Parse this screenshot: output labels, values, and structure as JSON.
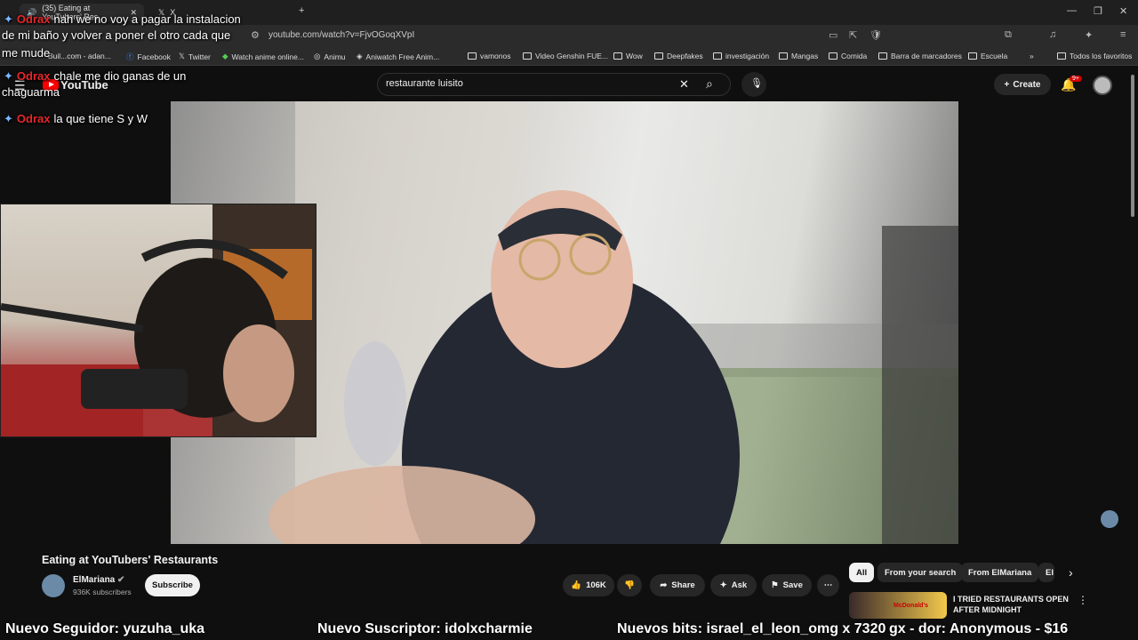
{
  "browser": {
    "tabs": [
      {
        "label": "(35) Eating at YouTubers' Res"
      },
      {
        "label": "X"
      }
    ],
    "url": "youtube.com/watch?v=FjvOGoqXVpI",
    "bookmarks": [
      {
        "label": "Buil...com - adan...",
        "icon": "site-icon"
      },
      {
        "label": "Facebook",
        "icon": "facebook-icon"
      },
      {
        "label": "Twitter",
        "icon": "x-icon"
      },
      {
        "label": "Watch anime online...",
        "icon": "site-icon"
      },
      {
        "label": "Animu",
        "icon": "globe-icon"
      },
      {
        "label": "Aniwatch Free Anim...",
        "icon": "site-icon"
      },
      {
        "label": "vamonos",
        "icon": "folder-icon"
      },
      {
        "label": "Video Genshin FUE...",
        "icon": "folder-icon"
      },
      {
        "label": "Wow",
        "icon": "folder-icon"
      },
      {
        "label": "Deepfakes",
        "icon": "folder-icon"
      },
      {
        "label": "investigación",
        "icon": "folder-icon"
      },
      {
        "label": "Mangas",
        "icon": "folder-icon"
      },
      {
        "label": "Comida",
        "icon": "folder-icon"
      },
      {
        "label": "Barra de marcadores",
        "icon": "folder-icon"
      },
      {
        "label": "Escuela",
        "icon": "folder-icon"
      },
      {
        "label": "Todos los favoritos",
        "icon": "folder-icon"
      }
    ]
  },
  "youtube": {
    "logo": "YouTube",
    "search_query": "restaurante luisito",
    "create_label": "Create",
    "notif_count": "9+",
    "video_title": "Eating at YouTubers' Restaurants",
    "channel_name": "ElMariana",
    "subscribers": "936K subscribers",
    "subscribe_label": "Subscribe",
    "likes": "106K",
    "share_label": "Share",
    "ask_label": "Ask",
    "save_label": "Save",
    "chips": [
      "All",
      "From your search",
      "From ElMariana",
      "El"
    ],
    "rec_title": "I TRIED RESTAURANTS OPEN AFTER MIDNIGHT",
    "rec_brand": "McDonald's"
  },
  "chat": [
    {
      "user": "Odrax",
      "text": "nah we no voy a pagar la instalacion"
    },
    {
      "user": "",
      "text": "de mi baño y volver a poner el otro cada que"
    },
    {
      "user": "",
      "text": "me mude"
    },
    {
      "user": "Odrax",
      "text": "chale me dio ganas de un"
    },
    {
      "user": "",
      "text": "chaguarma"
    },
    {
      "user": "Odrax",
      "text": "la que tiene S y W"
    }
  ],
  "ticker": {
    "follower": "Nuevo Seguidor: yuzuha_uka",
    "subscriber": "Nuevo Suscriptor: idolxcharmie",
    "bits": "Nuevos bits: israel_el_leon_omg x 7320",
    "donor": "gx - dor: Anonymous - $16"
  },
  "colors": {
    "accent": "#ff0000",
    "chat_user": "#e5282c"
  }
}
